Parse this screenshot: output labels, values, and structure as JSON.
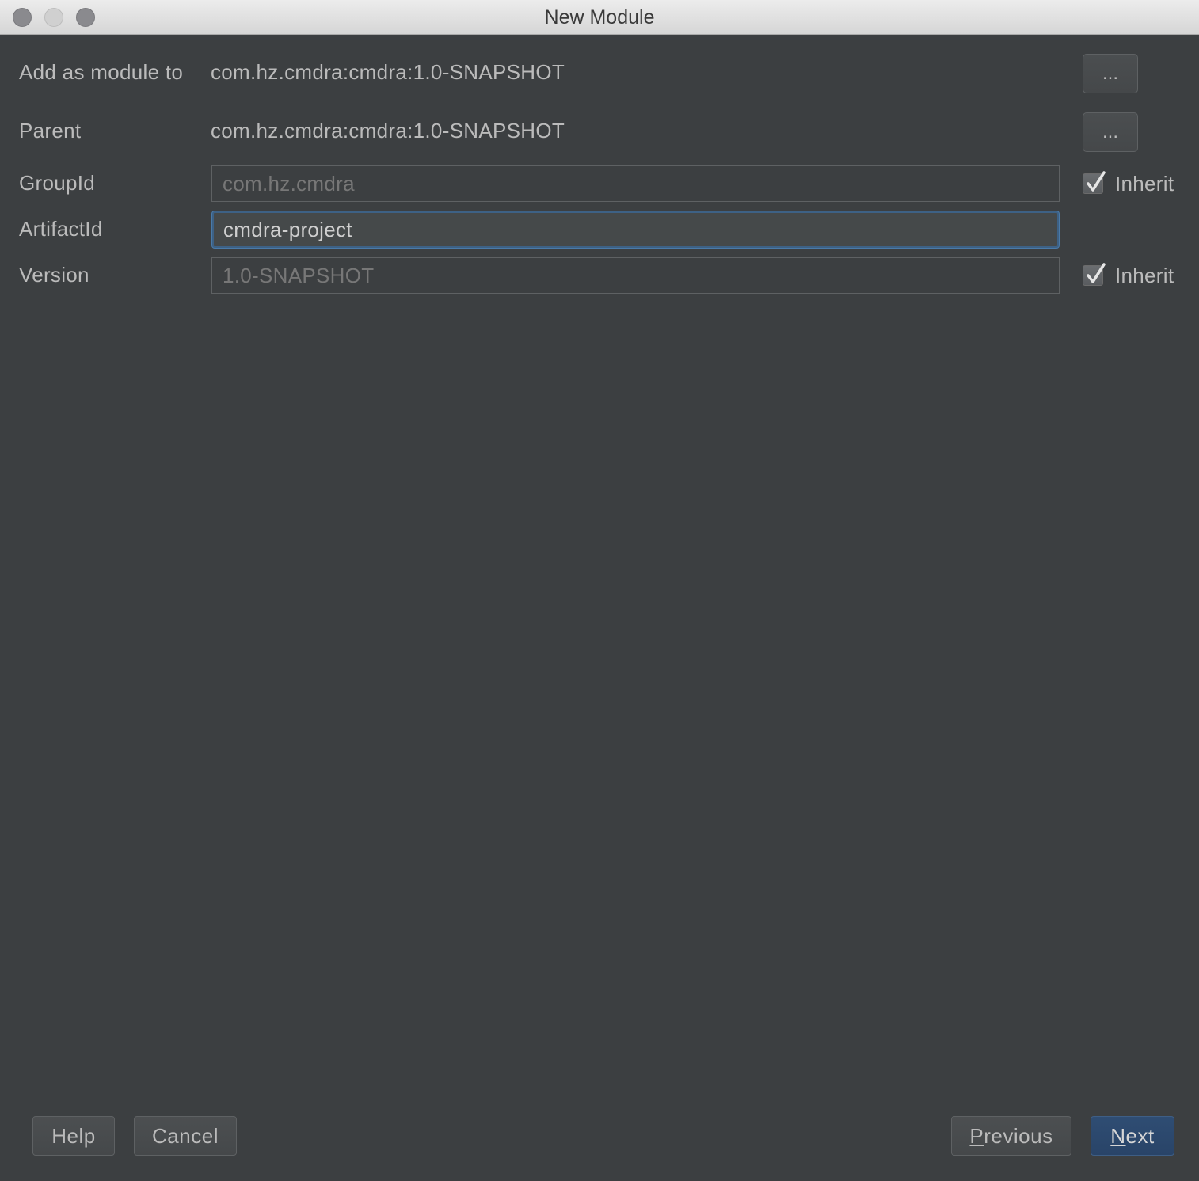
{
  "window": {
    "title": "New Module"
  },
  "form": {
    "add_as_module_to": {
      "label": "Add as module to",
      "value": "com.hz.cmdra:cmdra:1.0-SNAPSHOT",
      "browse_label": "..."
    },
    "parent": {
      "label": "Parent",
      "value": "com.hz.cmdra:cmdra:1.0-SNAPSHOT",
      "browse_label": "..."
    },
    "group_id": {
      "label": "GroupId",
      "value": "com.hz.cmdra",
      "inherit_label": "Inherit",
      "inherit_checked": true
    },
    "artifact_id": {
      "label": "ArtifactId",
      "value": "cmdra-project"
    },
    "version": {
      "label": "Version",
      "value": "1.0-SNAPSHOT",
      "inherit_label": "Inherit",
      "inherit_checked": true
    }
  },
  "buttons": {
    "help": "Help",
    "cancel": "Cancel",
    "previous_mnemonic": "P",
    "previous_rest": "revious",
    "next_mnemonic": "N",
    "next_rest": "ext"
  },
  "colors": {
    "background": "#3c3f41",
    "text": "#bbbbbb",
    "focus_border": "#3d6185",
    "default_button": "#2f4d73"
  }
}
